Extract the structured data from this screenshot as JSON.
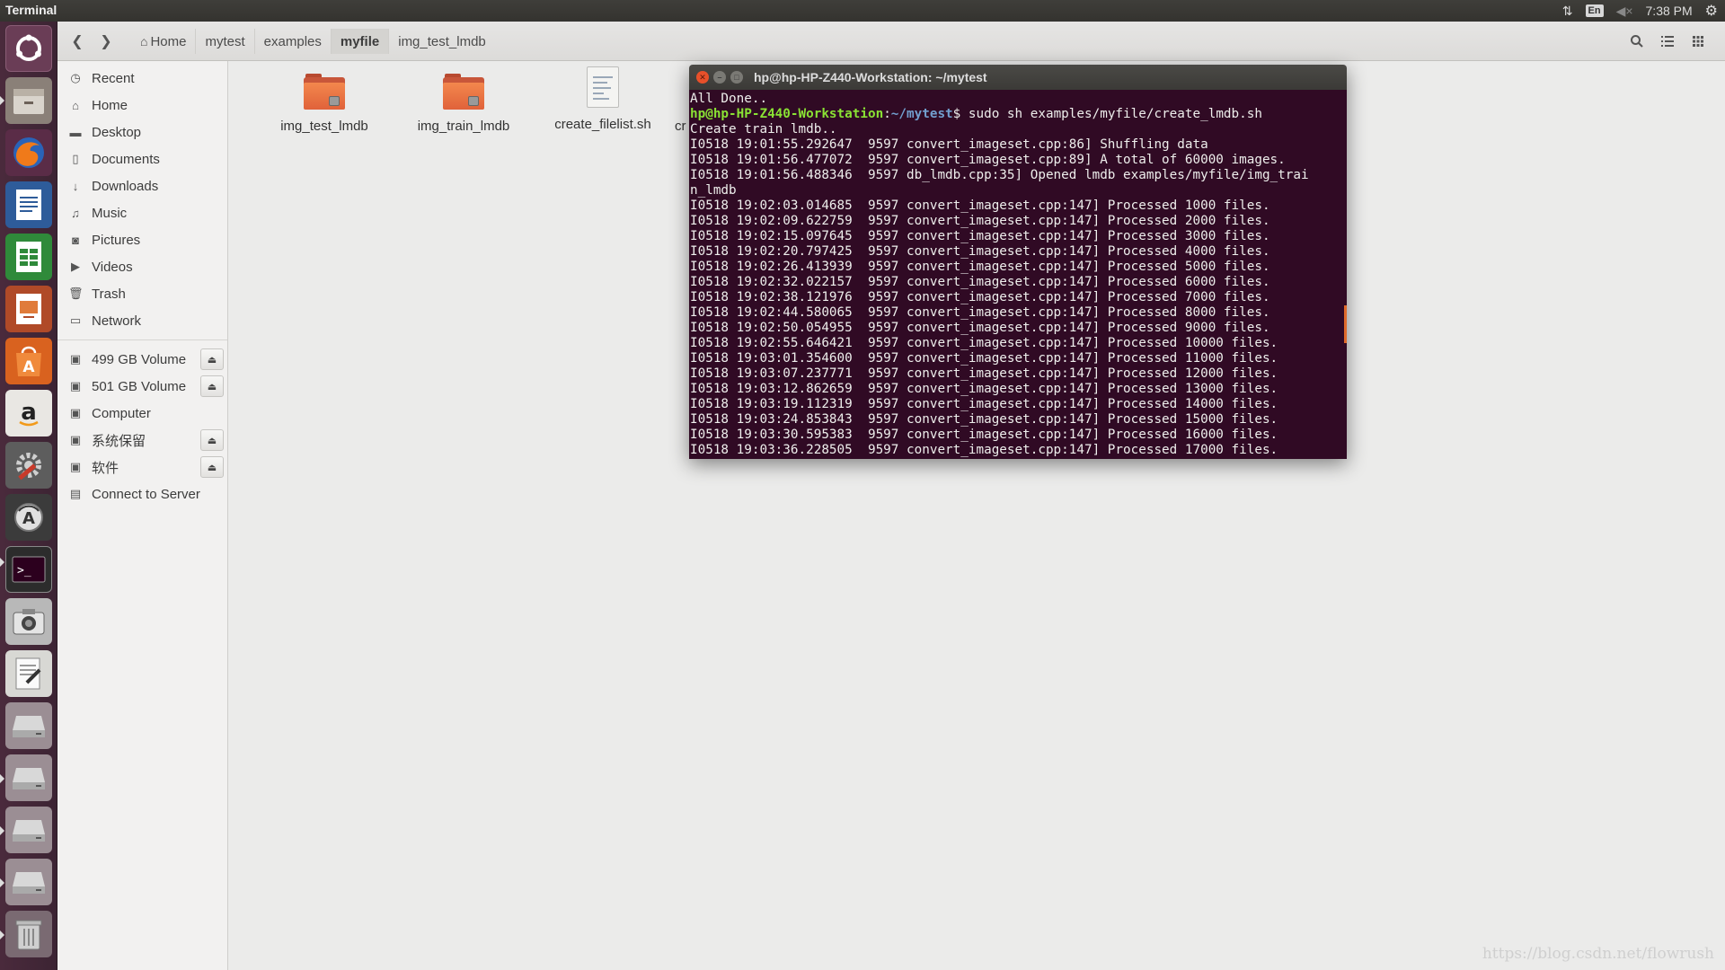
{
  "top_panel": {
    "app_title": "Terminal",
    "keyboard_layout": "En",
    "clock": "7:38 PM",
    "icons": [
      "network-transfer-icon",
      "keyboard-icon",
      "volume-muted-icon",
      "system-gear-icon"
    ]
  },
  "launcher": {
    "items": [
      "ubuntu-dash-icon",
      "files-icon",
      "firefox-icon",
      "libreoffice-writer-icon",
      "libreoffice-calc-icon",
      "libreoffice-impress-icon",
      "software-center-icon",
      "amazon-icon",
      "system-settings-icon",
      "software-updater-icon",
      "terminal-icon",
      "camera-icon",
      "text-editor-icon",
      "drive-icon",
      "drive-icon",
      "drive-icon",
      "drive-icon",
      "trash-icon"
    ]
  },
  "files_window": {
    "breadcrumbs": [
      {
        "label": "Home"
      },
      {
        "label": "mytest"
      },
      {
        "label": "examples"
      },
      {
        "label": "myfile"
      },
      {
        "label": "img_test_lmdb"
      }
    ],
    "active_crumb": "myfile",
    "sidebar": {
      "places": [
        {
          "label": "Recent",
          "icon": "clock-icon"
        },
        {
          "label": "Home",
          "icon": "home-icon"
        },
        {
          "label": "Desktop",
          "icon": "folder-icon"
        },
        {
          "label": "Documents",
          "icon": "document-icon"
        },
        {
          "label": "Downloads",
          "icon": "download-icon"
        },
        {
          "label": "Music",
          "icon": "music-icon"
        },
        {
          "label": "Pictures",
          "icon": "camera-icon"
        },
        {
          "label": "Videos",
          "icon": "video-icon"
        },
        {
          "label": "Trash",
          "icon": "trash-icon"
        },
        {
          "label": "Network",
          "icon": "network-icon"
        }
      ],
      "devices": [
        {
          "label": "499 GB Volume",
          "eject": true
        },
        {
          "label": "501 GB Volume",
          "eject": true
        },
        {
          "label": "Computer",
          "eject": false
        },
        {
          "label": "系统保留",
          "eject": true
        },
        {
          "label": "软件",
          "eject": true
        },
        {
          "label": "Connect to Server",
          "eject": false
        }
      ]
    },
    "files": [
      {
        "name": "img_test_lmdb",
        "type": "folder"
      },
      {
        "name": "img_train_lmdb",
        "type": "folder"
      },
      {
        "name": "create_filelist.sh",
        "type": "script"
      },
      {
        "name": "cr",
        "type": "partial"
      }
    ]
  },
  "terminal": {
    "title": "hp@hp-HP-Z440-Workstation: ~/mytest",
    "line_all_done": "All Done..",
    "prompt_user": "hp@hp-HP-Z440-Workstation",
    "prompt_sep": ":",
    "prompt_path": "~/mytest",
    "prompt_cmd": "$ sudo sh examples/myfile/create_lmdb.sh",
    "output_lines": [
      "Create train lmdb..",
      "I0518 19:01:55.292647  9597 convert_imageset.cpp:86] Shuffling data",
      "I0518 19:01:56.477072  9597 convert_imageset.cpp:89] A total of 60000 images.",
      "I0518 19:01:56.488346  9597 db_lmdb.cpp:35] Opened lmdb examples/myfile/img_trai",
      "n_lmdb",
      "I0518 19:02:03.014685  9597 convert_imageset.cpp:147] Processed 1000 files.",
      "I0518 19:02:09.622759  9597 convert_imageset.cpp:147] Processed 2000 files.",
      "I0518 19:02:15.097645  9597 convert_imageset.cpp:147] Processed 3000 files.",
      "I0518 19:02:20.797425  9597 convert_imageset.cpp:147] Processed 4000 files.",
      "I0518 19:02:26.413939  9597 convert_imageset.cpp:147] Processed 5000 files.",
      "I0518 19:02:32.022157  9597 convert_imageset.cpp:147] Processed 6000 files.",
      "I0518 19:02:38.121976  9597 convert_imageset.cpp:147] Processed 7000 files.",
      "I0518 19:02:44.580065  9597 convert_imageset.cpp:147] Processed 8000 files.",
      "I0518 19:02:50.054955  9597 convert_imageset.cpp:147] Processed 9000 files.",
      "I0518 19:02:55.646421  9597 convert_imageset.cpp:147] Processed 10000 files.",
      "I0518 19:03:01.354600  9597 convert_imageset.cpp:147] Processed 11000 files.",
      "I0518 19:03:07.237771  9597 convert_imageset.cpp:147] Processed 12000 files.",
      "I0518 19:03:12.862659  9597 convert_imageset.cpp:147] Processed 13000 files.",
      "I0518 19:03:19.112319  9597 convert_imageset.cpp:147] Processed 14000 files.",
      "I0518 19:03:24.853843  9597 convert_imageset.cpp:147] Processed 15000 files.",
      "I0518 19:03:30.595383  9597 convert_imageset.cpp:147] Processed 16000 files.",
      "I0518 19:03:36.228505  9597 convert_imageset.cpp:147] Processed 17000 files."
    ]
  },
  "watermark": "https://blog.csdn.net/flowrush",
  "colors": {
    "launcher_bg": "#4a2a3c",
    "terminal_bg": "#300a24",
    "prompt_user": "#8ae234",
    "prompt_path": "#729fcf",
    "folder_orange": "#e0623a",
    "close_button": "#e8502a"
  }
}
